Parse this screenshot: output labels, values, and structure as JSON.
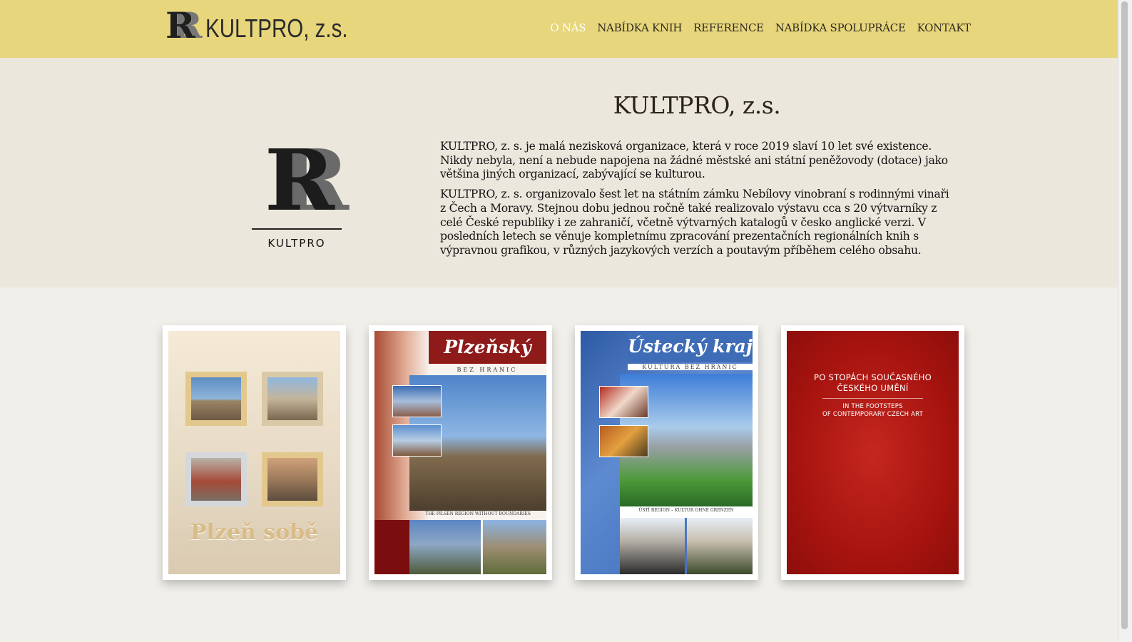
{
  "header": {
    "brand_text": "KULTPRO, z.s.",
    "brand_mark": "R",
    "nav": [
      "O NÁS",
      "NABÍDKA KNIH",
      "REFERENCE",
      "NABÍDKA SPOLUPRÁCE",
      "KONTAKT"
    ],
    "active_nav": "O NÁS"
  },
  "intro": {
    "logo_mark": "R",
    "logo_caption": "KULTPRO",
    "title": "KULTPRO, z.s.",
    "paragraphs": [
      "KULTPRO, z. s. je malá nezisková organizace, která v roce 2019 slaví 10 let své existence. Nikdy nebyla, není a nebude napojena na žádné městské ani státní peněžovody (dotace) jako většina jiných organizací, zabývající se kulturou.",
      "KULTPRO, z. s. organizovalo šest let na státním zámku Nebílovy vinobraní s rodinnými vinaři z Čech a Moravy. Stejnou dobu jednou ročně také realizovalo výstavu cca s 20 výtvarníky z celé České republiky i ze zahraničí, včetně výtvarných katalogů v česko anglické verzi. V posledních letech se věnuje kompletnímu zpracování prezentačních regionálních knih s výpravnou grafikou, v různých jazykových verzích a poutavým příběhem celého obsahu."
    ]
  },
  "books": [
    {
      "title": "Plzeň sobě"
    },
    {
      "title": "Plzeňský kraj",
      "subtitle": "BEZ HRANIC",
      "caption": "THE PILSEN REGION WITHOUT BOUNDARIES"
    },
    {
      "title": "Ústecký kraj",
      "subtitle": "KULTURA BEZ HRANIC",
      "caption": "ÚSTÍ REGION – KULTUR OHNE GRENZEN"
    },
    {
      "title_line1": "PO STOPÁCH SOUČASNÉHO",
      "title_line2": "ČESKÉHO UMĚNÍ",
      "subtitle_line1": "IN THE FOOTSTEPS",
      "subtitle_line2": "OF CONTEMPORARY CZECH ART"
    }
  ],
  "colors": {
    "header_bg": "#e7d67b",
    "active_nav": "#ffffff",
    "text_dark": "#2e2a22"
  }
}
